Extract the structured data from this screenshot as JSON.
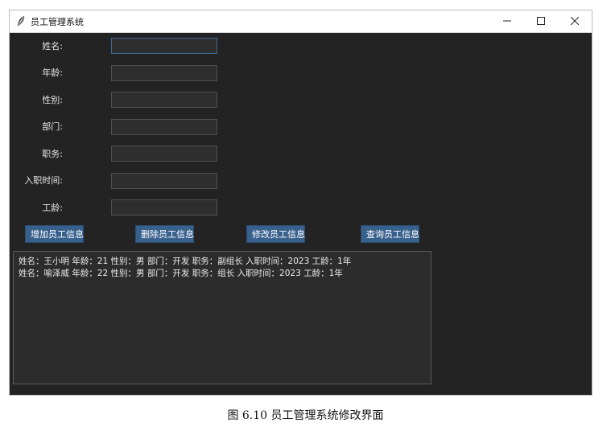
{
  "window": {
    "title": "员工管理系统",
    "app_icon": "feather-icon",
    "controls": [
      "minimize-icon",
      "maximize-icon",
      "close-icon"
    ]
  },
  "form": {
    "fields": [
      {
        "label": "姓名:",
        "value": ""
      },
      {
        "label": "年龄:",
        "value": ""
      },
      {
        "label": "性别:",
        "value": ""
      },
      {
        "label": "部门:",
        "value": ""
      },
      {
        "label": "职务:",
        "value": ""
      },
      {
        "label": "入职时间:",
        "value": ""
      },
      {
        "label": "工龄:",
        "value": ""
      }
    ]
  },
  "buttons": {
    "add": "增加员工信息",
    "delete": "删除员工信息",
    "modify": "修改员工信息",
    "query": "查询员工信息"
  },
  "output": {
    "lines": [
      "姓名：王小明 年龄：21 性别：男 部门：开发 职务：副组长 入职时间：2023 工龄：1年",
      "姓名：喻泽威 年龄：22 性别：男 部门：开发 职务：组长 入职时间：2023 工龄：1年"
    ]
  },
  "caption": "图 6.10  员工管理系统修改界面",
  "colors": {
    "window_bg": "#232323",
    "entry_bg": "#2e2e2e",
    "button_bg": "#38608d",
    "text": "#e6e6e6"
  }
}
